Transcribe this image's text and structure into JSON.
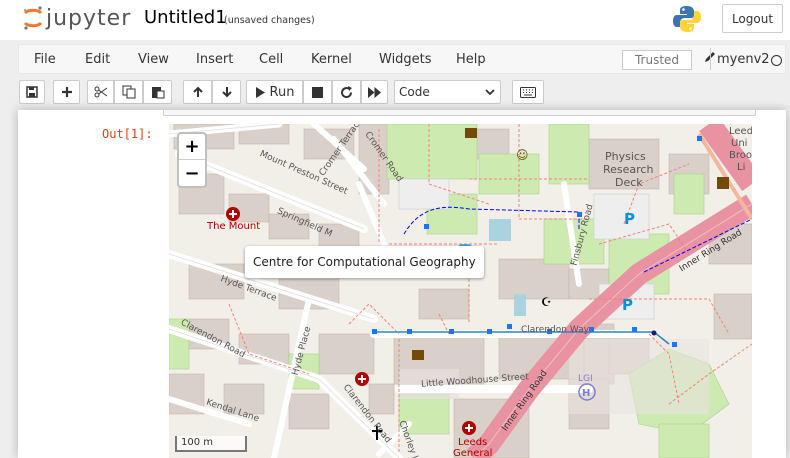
{
  "header": {
    "logo_text": "jupyter",
    "notebook_title": "Untitled1",
    "autosave_status": "(unsaved changes)",
    "logout_label": "Logout"
  },
  "menubar": {
    "items": [
      "File",
      "Edit",
      "View",
      "Insert",
      "Cell",
      "Kernel",
      "Widgets",
      "Help"
    ],
    "trusted_label": "Trusted",
    "kernel_name": "myenv2"
  },
  "toolbar": {
    "run_label": "Run",
    "cell_type": "Code"
  },
  "cell": {
    "out_prompt": "Out[1]:"
  },
  "map": {
    "zoom_in": "+",
    "zoom_out": "−",
    "popup_text": "Centre for Computational Geography",
    "scale_label": "100 m",
    "labels": {
      "the_mount": "The Mount",
      "mount_preston": "Mount Preston Street",
      "springfield": "Springfield M",
      "cromer_terrace": "Cromer Terrace",
      "cromer_road": "Cromer Road",
      "hyde_terrace": "Hyde Terrace",
      "clarendon_road": "Clarendon Road",
      "clarendon_road2": "Clarendon Road",
      "hyde_place": "Hyde Place",
      "kendal_lane": "Kendal Lane",
      "physics": "Physics",
      "research": "Research",
      "deck": "Deck",
      "fenton": "Finsbury Road",
      "inner_ring": "Inner Ring Road",
      "inner_ring2": "Inner Ring Road",
      "clarendon_way": "Clarendon Way",
      "little_woodhouse": "Little Woodhouse Street",
      "lgi": "LGI",
      "leeds_general": "Leeds",
      "leeds_general2": "General",
      "chorley": "Chorley L",
      "leeds_uni": "Leeds",
      "leeds_uni2": "Uni",
      "leeds_uni3": "Broo",
      "leeds_uni4": "Li"
    }
  }
}
